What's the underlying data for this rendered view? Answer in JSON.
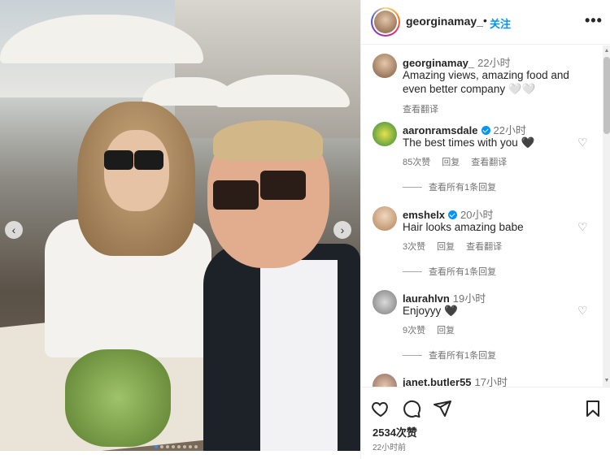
{
  "header": {
    "username": "georginamay_",
    "dot": "•",
    "follow_label": "关注",
    "more_icon": "more-horizontal-icon"
  },
  "caption": {
    "username": "georginamay_",
    "time": "22小时",
    "text": "Amazing views, amazing food and even better company 🤍🤍",
    "translate_label": "查看翻译"
  },
  "comments": [
    {
      "username": "aaronramsdale",
      "verified": true,
      "time": "22小时",
      "text": "The best times with you 🖤",
      "likes": "85次赞",
      "reply_label": "回复",
      "translate_label": "查看翻译",
      "view_replies": "查看所有1条回复"
    },
    {
      "username": "emshelx",
      "verified": true,
      "time": "20小时",
      "text": "Hair looks amazing babe",
      "likes": "3次赞",
      "reply_label": "回复",
      "translate_label": "查看翻译",
      "view_replies": "查看所有1条回复"
    },
    {
      "username": "laurahlvn",
      "verified": false,
      "time": "19小时",
      "text": "Enjoyyy 🖤",
      "likes": "9次赞",
      "reply_label": "回复",
      "view_replies": "查看所有1条回复"
    },
    {
      "username": "janet.butler55",
      "verified": false,
      "time": "17小时"
    }
  ],
  "actions": {
    "like_icon": "heart-outline-icon",
    "comment_icon": "comment-icon",
    "share_icon": "send-icon",
    "save_icon": "bookmark-icon",
    "likes_count": "2534次赞",
    "post_time": "22小时前"
  },
  "carousel": {
    "prev_icon": "chevron-left-icon",
    "next_icon": "chevron-right-icon",
    "slide_count": 8,
    "active_index": 0
  },
  "colors": {
    "accent": "#0095f6",
    "text": "#262626",
    "muted": "#737373"
  }
}
